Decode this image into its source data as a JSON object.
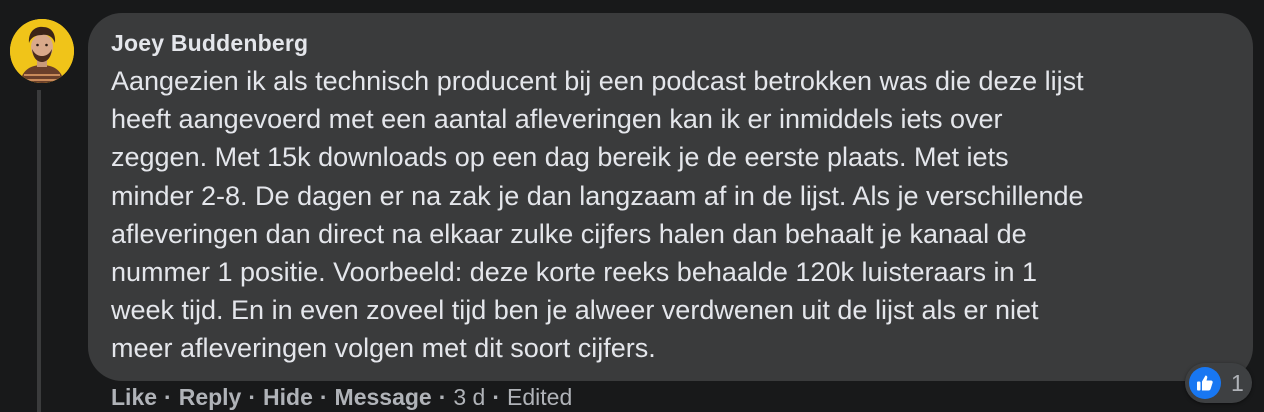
{
  "comment": {
    "author": "Joey Buddenberg",
    "lines": [
      "Aangezien ik als technisch producent bij een podcast betrokken was die deze lijst",
      "heeft aangevoerd met een aantal afleveringen kan ik er inmiddels iets over",
      "zeggen. Met 15k downloads op een dag bereik je de eerste plaats. Met iets",
      "minder 2-8. De dagen er na zak je dan langzaam af in de lijst. Als je verschillende",
      "afleveringen dan direct na elkaar zulke cijfers halen dan behaalt je kanaal de",
      "nummer 1 positie. Voorbeeld: deze korte reeks behaalde 120k luisteraars in 1",
      "week tijd. En in even zoveel tijd ben je alweer verdwenen uit de lijst als er niet",
      "meer afleveringen volgen met dit soort cijfers."
    ]
  },
  "actions": {
    "like": "Like",
    "reply": "Reply",
    "hide": "Hide",
    "message": "Message",
    "time": "3 d",
    "edited": "Edited",
    "separator": "·"
  },
  "reaction": {
    "icon": "thumbs-up-icon",
    "count": "1"
  },
  "colors": {
    "background": "#18191a",
    "bubble": "#3a3b3c",
    "text": "#e4e6eb",
    "secondary": "#b0b3b8",
    "like_blue": "#1877f2",
    "avatar_bg": "#f0c419"
  }
}
